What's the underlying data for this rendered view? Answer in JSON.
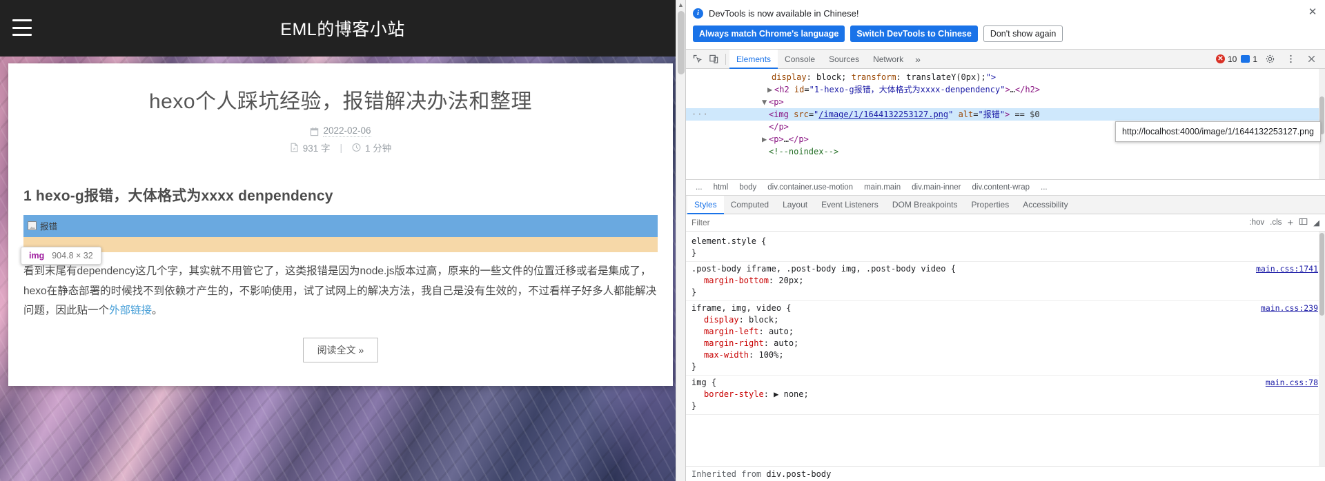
{
  "browser": {
    "site_title": "EML的博客小站",
    "menu_icon": "hamburger-icon",
    "post": {
      "title": "hexo个人踩坑经验，报错解决办法和整理",
      "date": "2022-02-06",
      "word_count": "931 字",
      "read_time": "1 分钟",
      "separator": "|",
      "heading": "1 hexo-g报错，大体格式为xxxx denpendency",
      "broken_image_alt": "报错",
      "paragraph_part1": "看到末尾有dependency这几个字，其实就不用管它了，这类报错是因为node.js版本过高，原来的一些文件的位置迁移或者是集成了，hexo在静态部署的时候找不到依赖才产生的，不影响使用，试了试网上的解决方法，我自己是没有生效的，不过看样子好多人都能解决问题，因此贴一个",
      "link_text": "外部链接",
      "paragraph_part2": "。",
      "read_more": "阅读全文 »"
    },
    "inspect_badge": {
      "tag": "img",
      "dimensions": "904.8 × 32"
    }
  },
  "devtools": {
    "notification": {
      "message": "DevTools is now available in Chinese!",
      "btn_always": "Always match Chrome's language",
      "btn_switch": "Switch DevTools to Chinese",
      "btn_dismiss": "Don't show again",
      "close": "✕"
    },
    "tabs": [
      {
        "label": "Elements",
        "active": true
      },
      {
        "label": "Console",
        "active": false
      },
      {
        "label": "Sources",
        "active": false
      },
      {
        "label": "Network",
        "active": false
      }
    ],
    "tabs_overflow": "»",
    "error_count": "10",
    "warning_count": "1",
    "settings_icon": "gear-icon",
    "kebab_icon": "more-vertical-icon",
    "close_icon": "close-icon",
    "inspect_icon": "inspect-element-icon",
    "device_icon": "device-toolbar-icon",
    "dom": [
      {
        "indent": 3,
        "text": "display: block; transform: translateY(0px);\">",
        "type": "attr-tail"
      },
      {
        "indent": 4,
        "text": "<h2 id=\"1-hexo-g报错，大体格式为xxxx-denpendency\">…</h2>",
        "type": "node",
        "arrow": "▶"
      },
      {
        "indent": 3,
        "text": "<p>",
        "type": "node",
        "arrow": "▼"
      },
      {
        "indent": 5,
        "text": "<img src=\"/image/1/1644132253127.png\" alt=\"报错\"> == $0",
        "type": "selected"
      },
      {
        "indent": 4,
        "text": "</p>",
        "type": "node"
      },
      {
        "indent": 3,
        "text": "<p>…</p>",
        "type": "node",
        "arrow": "▶"
      },
      {
        "indent": 4,
        "text": "<!--noindex-->",
        "type": "comment"
      }
    ],
    "url_tooltip": "http://localhost:4000/image/1/1644132253127.png",
    "breadcrumb": [
      {
        "label": "...",
        "selected": false
      },
      {
        "label": "html",
        "selected": false
      },
      {
        "label": "body",
        "selected": false
      },
      {
        "label": "div.container.use-motion",
        "selected": false
      },
      {
        "label": "main.main",
        "selected": false
      },
      {
        "label": "div.main-inner",
        "selected": false
      },
      {
        "label": "div.content-wrap",
        "selected": false
      },
      {
        "label": "...",
        "selected": false
      }
    ],
    "subtabs": [
      {
        "label": "Styles",
        "active": true
      },
      {
        "label": "Computed",
        "active": false
      },
      {
        "label": "Layout",
        "active": false
      },
      {
        "label": "Event Listeners",
        "active": false
      },
      {
        "label": "DOM Breakpoints",
        "active": false
      },
      {
        "label": "Properties",
        "active": false
      },
      {
        "label": "Accessibility",
        "active": false
      }
    ],
    "filter": {
      "placeholder": "Filter",
      "hov": ":hov",
      "cls": ".cls",
      "plus": "+",
      "panel_icon": "toggle-panel-icon"
    },
    "style_rules": [
      {
        "selector": "element.style",
        "source": "",
        "declarations": []
      },
      {
        "selector": ".post-body iframe, .post-body img, .post-body video",
        "source": "main.css:1741",
        "declarations": [
          {
            "prop": "margin-bottom",
            "value": "20px;"
          }
        ]
      },
      {
        "selector": "iframe, img, video",
        "source": "main.css:239",
        "declarations": [
          {
            "prop": "display",
            "value": "block;"
          },
          {
            "prop": "margin-left",
            "value": "auto;"
          },
          {
            "prop": "margin-right",
            "value": "auto;"
          },
          {
            "prop": "max-width",
            "value": "100%;"
          }
        ]
      },
      {
        "selector": "img",
        "source": "main.css:78",
        "declarations": [
          {
            "prop": "border-style",
            "value": "▶ none;"
          }
        ]
      }
    ],
    "inherited_from_label": "Inherited from ",
    "inherited_from_target": "div.post-body"
  }
}
